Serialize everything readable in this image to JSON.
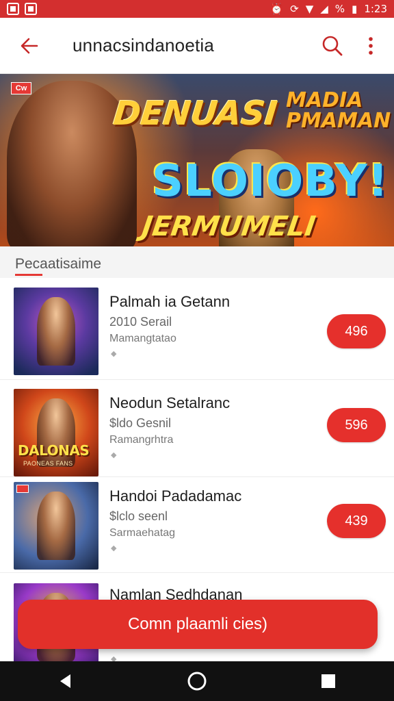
{
  "status_bar": {
    "battery": "%",
    "time": "1:23"
  },
  "app_bar": {
    "title": "unnacsindanoetia"
  },
  "banner": {
    "tag": "Cw",
    "title_1": "DENUASI",
    "title_2_line1": "MADIA",
    "title_2_line2": "PMAMAN",
    "title_3": "SLOIOBY!",
    "title_4": "JERMUMELI"
  },
  "section": {
    "title": "Pecaatisaime"
  },
  "items": [
    {
      "title": "Palmah ia Getann",
      "sub": "2010 Serail",
      "meta": "Mamangtatao",
      "dot": "◆",
      "price": "496",
      "thumb_caption": "",
      "thumb_subcaption": ""
    },
    {
      "title": "Neodun Setalranc",
      "sub": "$ldo Gesnil",
      "meta": "Ramangrhtra",
      "dot": "◆",
      "price": "596",
      "thumb_caption": "DALONAS",
      "thumb_subcaption": "PAONEAS FANS"
    },
    {
      "title": "Handoi Padadamac",
      "sub": "$lclo seenl",
      "meta": "Sarmaehatag",
      "dot": "◆",
      "price": "439",
      "thumb_caption": "",
      "thumb_subcaption": ""
    },
    {
      "title": "Namlan Sedhdanan",
      "sub": "",
      "meta": "",
      "dot": "◆",
      "price": "",
      "thumb_caption": "",
      "thumb_subcaption": ""
    }
  ],
  "cta": {
    "label": "Comn plaamli cies)"
  },
  "colors": {
    "accent": "#e5302c",
    "status_bar": "#d32f2f",
    "nav_bar": "#111111"
  }
}
